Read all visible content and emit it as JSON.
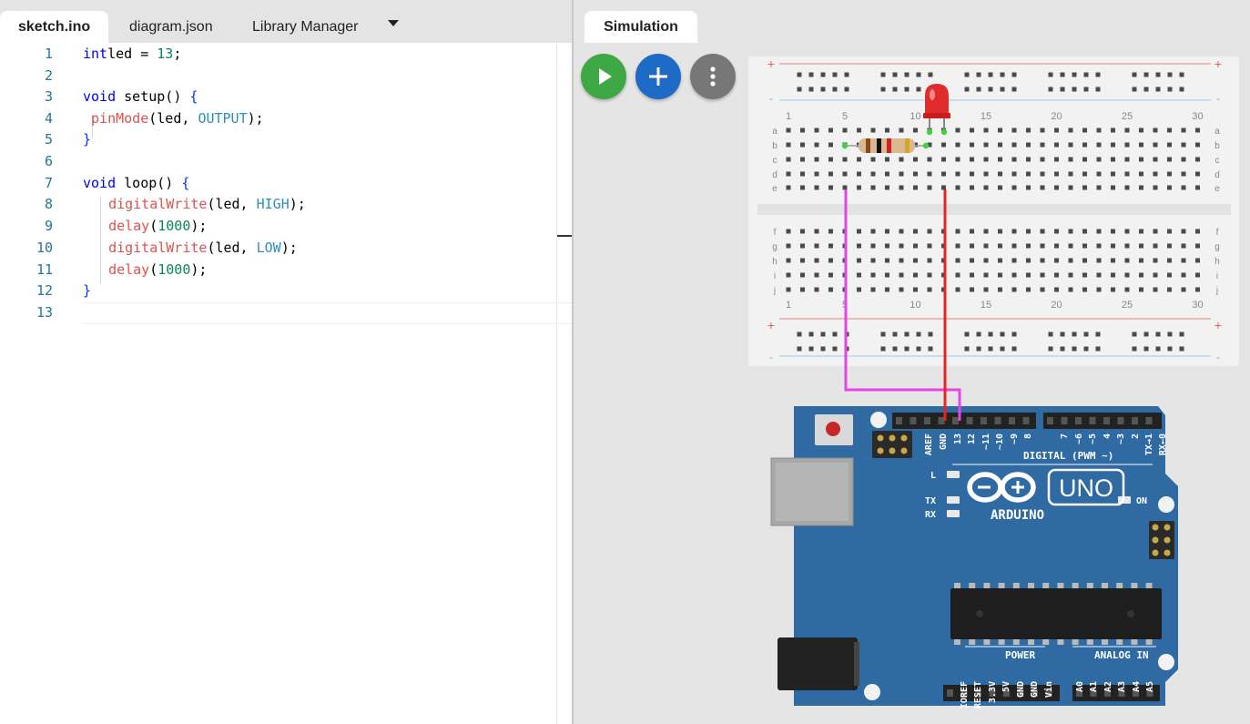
{
  "tabs": [
    {
      "label": "sketch.ino",
      "active": true
    },
    {
      "label": "diagram.json",
      "active": false
    },
    {
      "label": "Library Manager",
      "active": false
    }
  ],
  "code_lines": [
    {
      "n": "1",
      "tokens": [
        [
          "kw",
          "int"
        ],
        [
          "",
          "led = "
        ],
        [
          "num",
          "13"
        ],
        [
          "",
          ";"
        ]
      ]
    },
    {
      "n": "2",
      "tokens": []
    },
    {
      "n": "3",
      "tokens": [
        [
          "kw",
          "void"
        ],
        [
          "",
          " setup() "
        ],
        [
          "brk",
          "{"
        ]
      ]
    },
    {
      "n": "4",
      "tokens": [
        [
          "",
          " "
        ],
        [
          "fn",
          "pinMode"
        ],
        [
          "",
          "(led, "
        ],
        [
          "cst",
          "OUTPUT"
        ],
        [
          "",
          ");"
        ]
      ]
    },
    {
      "n": "5",
      "tokens": [
        [
          "brk",
          "}"
        ]
      ]
    },
    {
      "n": "6",
      "tokens": []
    },
    {
      "n": "7",
      "tokens": [
        [
          "kw",
          "void"
        ],
        [
          "",
          " loop() "
        ],
        [
          "brk",
          "{"
        ]
      ]
    },
    {
      "n": "8",
      "tokens": [
        [
          "",
          "  "
        ],
        [
          "fn",
          "digitalWrite"
        ],
        [
          "",
          "(led, "
        ],
        [
          "cst",
          "HIGH"
        ],
        [
          "",
          ");"
        ]
      ]
    },
    {
      "n": "9",
      "tokens": [
        [
          "",
          "  "
        ],
        [
          "fn",
          "delay"
        ],
        [
          "",
          "("
        ],
        [
          "num",
          "1000"
        ],
        [
          "",
          ");"
        ]
      ]
    },
    {
      "n": "10",
      "tokens": [
        [
          "",
          "  "
        ],
        [
          "fn",
          "digitalWrite"
        ],
        [
          "",
          "(led, "
        ],
        [
          "cst",
          "LOW"
        ],
        [
          "",
          ");"
        ]
      ]
    },
    {
      "n": "11",
      "tokens": [
        [
          "",
          "  "
        ],
        [
          "fn",
          "delay"
        ],
        [
          "",
          "("
        ],
        [
          "num",
          "1000"
        ],
        [
          "",
          ");"
        ]
      ]
    },
    {
      "n": "12",
      "tokens": [
        [
          "brk",
          "}"
        ]
      ]
    },
    {
      "n": "13",
      "tokens": []
    }
  ],
  "simulation": {
    "tab_label": "Simulation",
    "buttons": [
      {
        "name": "start-simulation-button",
        "icon": "play-icon",
        "color": "#3ea845"
      },
      {
        "name": "add-part-button",
        "icon": "plus-icon",
        "color": "#1d6ac7"
      },
      {
        "name": "more-options-button",
        "icon": "more-vert-icon",
        "color": "#777777"
      }
    ]
  },
  "breadboard": {
    "columns": [
      "1",
      "5",
      "10",
      "15",
      "20",
      "25",
      "30"
    ],
    "rows_top": [
      "a",
      "b",
      "c",
      "d",
      "e"
    ],
    "rows_bottom": [
      "f",
      "g",
      "h",
      "i",
      "j"
    ],
    "rail_plus": "+",
    "rail_minus": "-"
  },
  "arduino": {
    "brand": "ARDUINO",
    "model": "UNO",
    "digital_label": "DIGITAL (PWM ~)",
    "digital_pins": [
      "AREF",
      "GND",
      "13",
      "12",
      "~11",
      "~10",
      "~9",
      "8",
      "7",
      "~6",
      "~5",
      "4",
      "~3",
      "2",
      "TX→1",
      "RX←0"
    ],
    "led_labels": [
      "L",
      "TX",
      "RX"
    ],
    "on_label": "ON",
    "power_label": "POWER",
    "power_pins": [
      "IOREF",
      "RESET",
      "3.3V",
      "5V",
      "GND",
      "GND",
      "Vin"
    ],
    "analog_label": "ANALOG IN",
    "analog_pins": [
      "A0",
      "A1",
      "A2",
      "A3",
      "A4",
      "A5"
    ]
  },
  "colors": {
    "board_blue": "#2f6aa3",
    "wire_gnd": "#e645e6",
    "wire_signal": "#e8251d",
    "led_red": "#e02c2c"
  }
}
